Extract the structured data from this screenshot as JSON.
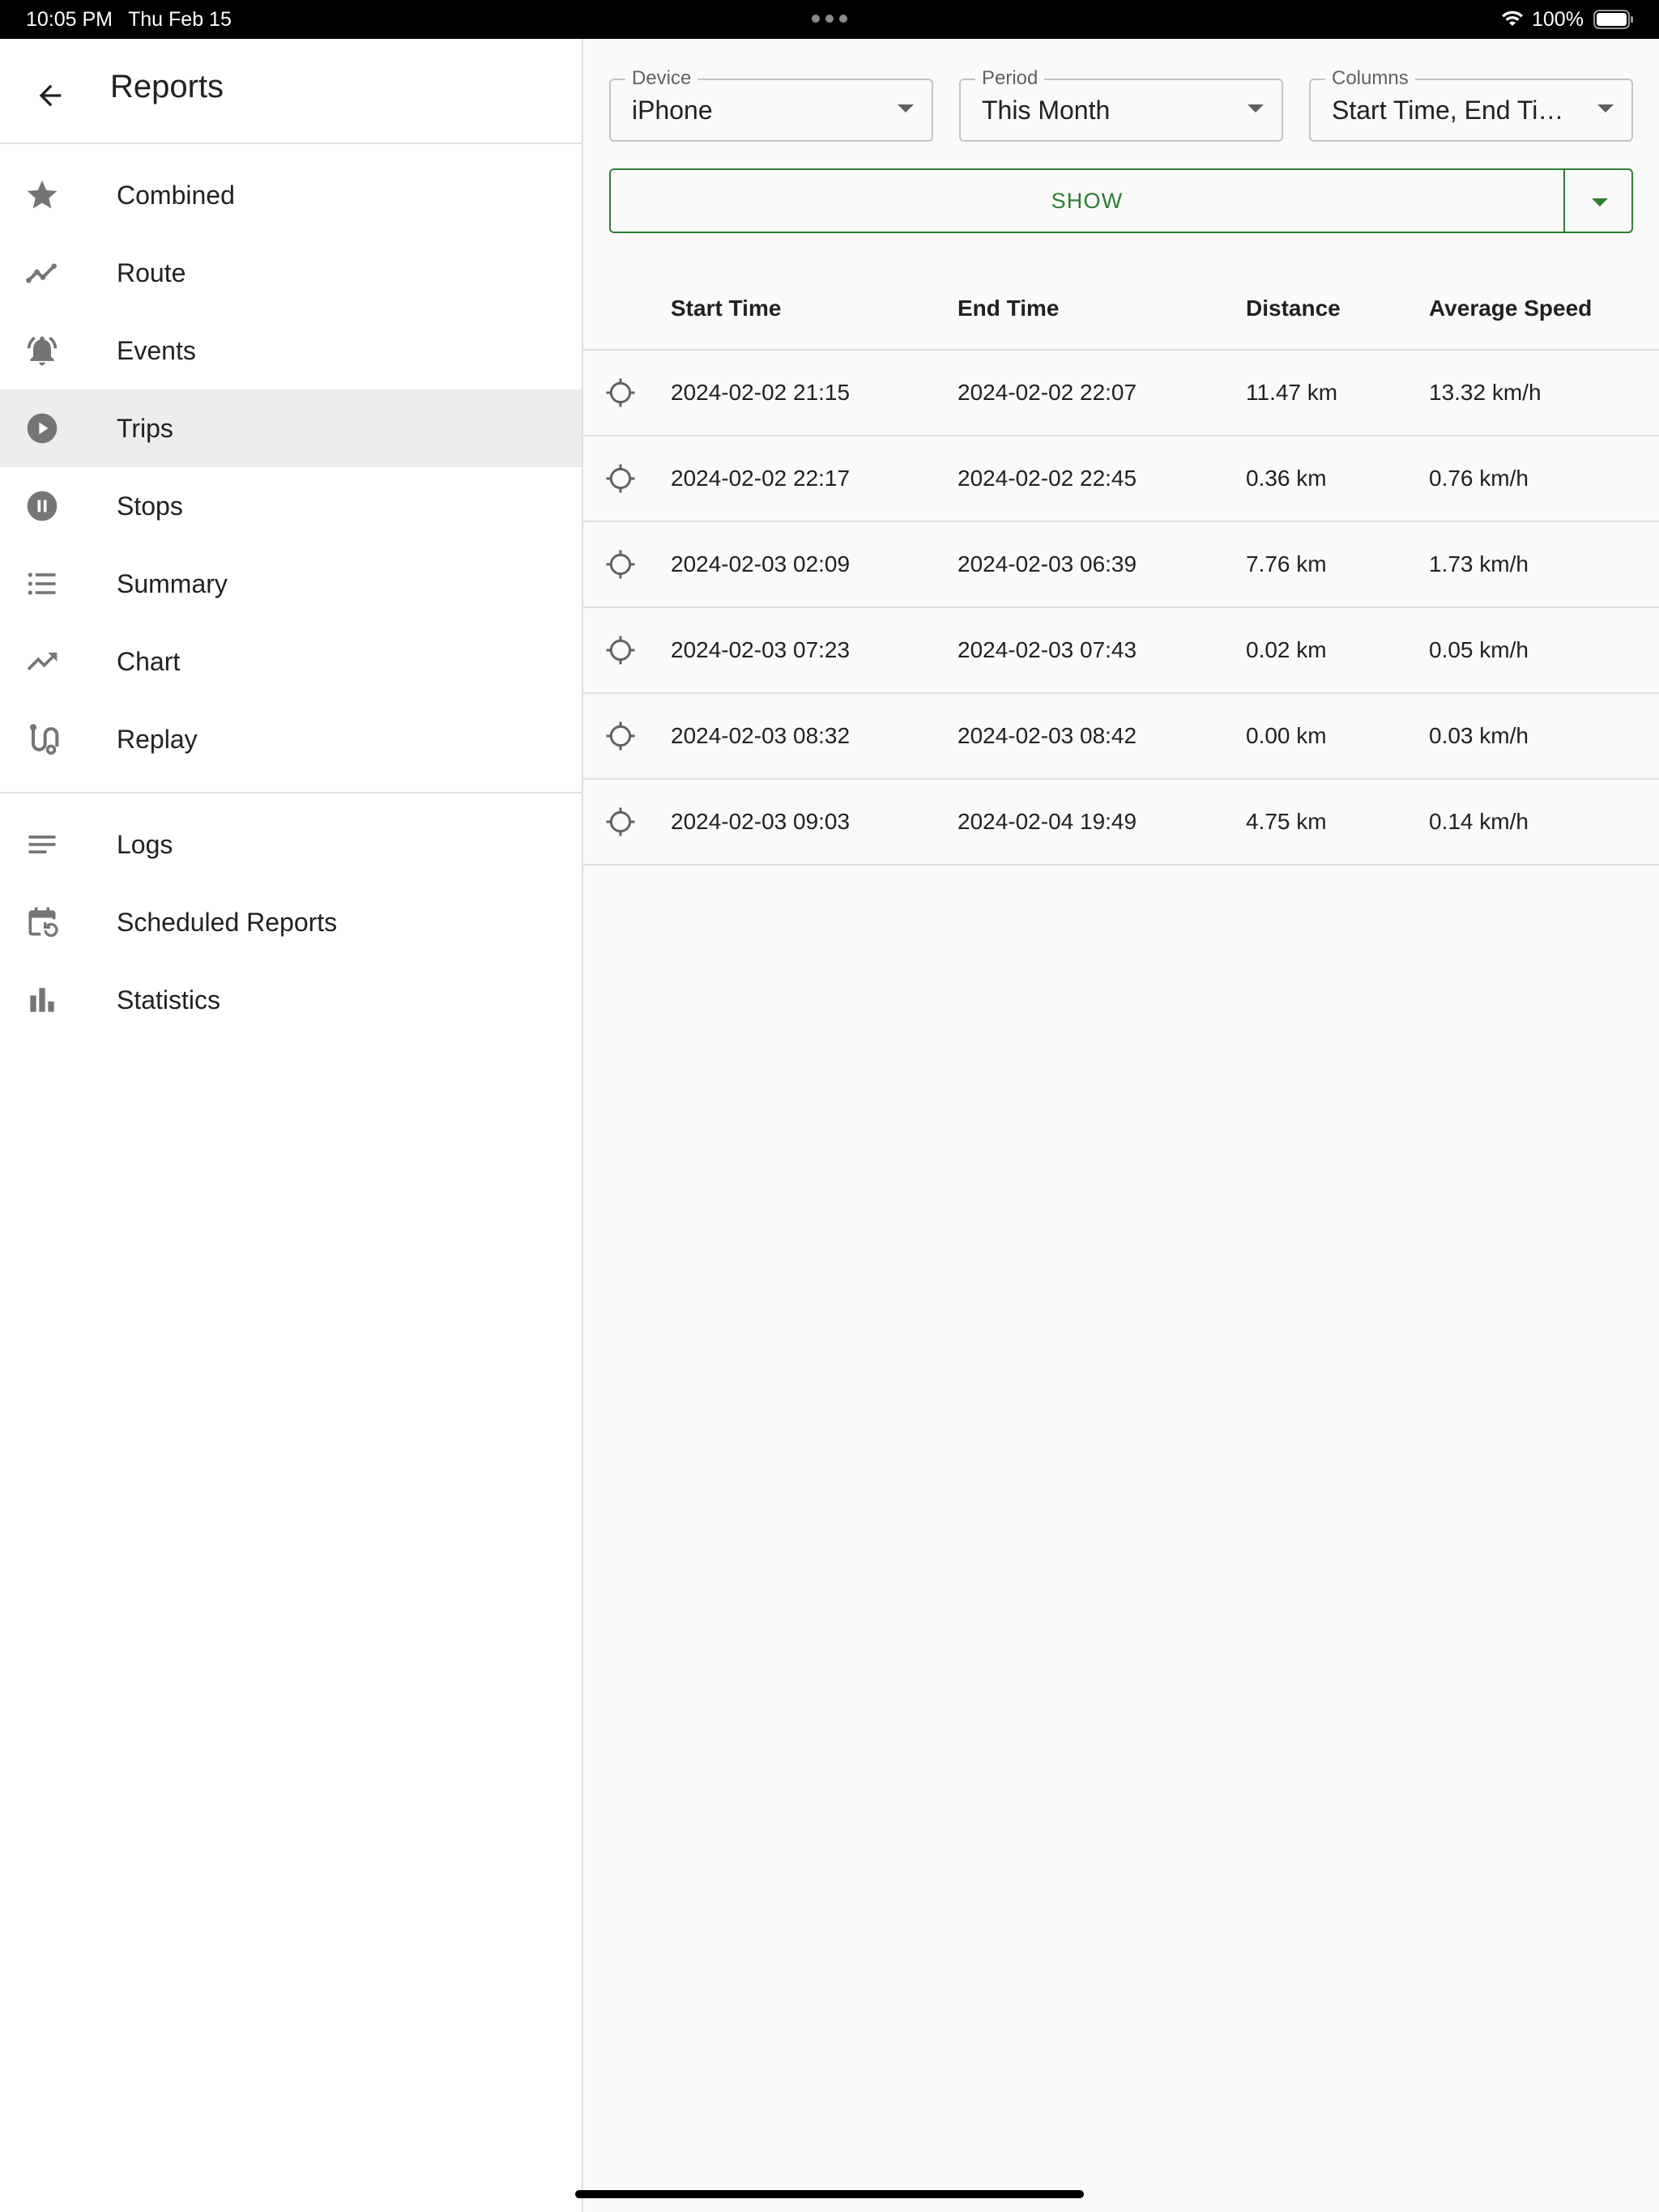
{
  "status_bar": {
    "time": "10:05 PM",
    "date": "Thu Feb 15",
    "battery": "100%",
    "icons": [
      "wifi-icon",
      "battery-icon",
      "multitasking-dots-icon"
    ]
  },
  "sidebar": {
    "title": "Reports",
    "back_icon": "arrow-left-icon",
    "items": [
      {
        "label": "Combined",
        "icon": "star-icon",
        "selected": false
      },
      {
        "label": "Route",
        "icon": "timeline-icon",
        "selected": false
      },
      {
        "label": "Events",
        "icon": "notifications-active-icon",
        "selected": false
      },
      {
        "label": "Trips",
        "icon": "play-circle-icon",
        "selected": true
      },
      {
        "label": "Stops",
        "icon": "pause-circle-icon",
        "selected": false
      },
      {
        "label": "Summary",
        "icon": "format-list-bulleted-icon",
        "selected": false
      },
      {
        "label": "Chart",
        "icon": "trending-up-icon",
        "selected": false
      },
      {
        "label": "Replay",
        "icon": "route-icon",
        "selected": false
      }
    ],
    "secondary_items": [
      {
        "label": "Logs",
        "icon": "notes-icon"
      },
      {
        "label": "Scheduled Reports",
        "icon": "event-repeat-icon"
      },
      {
        "label": "Statistics",
        "icon": "bar-chart-icon"
      }
    ]
  },
  "filters": {
    "device": {
      "label": "Device",
      "value": "iPhone"
    },
    "period": {
      "label": "Period",
      "value": "This Month"
    },
    "columns": {
      "label": "Columns",
      "value": "Start Time, End Time, Distance, Average Speed"
    },
    "show_label": "SHOW"
  },
  "colors": {
    "accent": "#2e7d32",
    "selected_bg": "#ededed",
    "divider": "#e0e0e0"
  },
  "table": {
    "columns": [
      "Start Time",
      "End Time",
      "Distance",
      "Average Speed"
    ],
    "row_icon": "gps-crosshair-icon",
    "rows": [
      [
        "2024-02-02 21:15",
        "2024-02-02 22:07",
        "11.47 km",
        "13.32 km/h"
      ],
      [
        "2024-02-02 22:17",
        "2024-02-02 22:45",
        "0.36 km",
        "0.76 km/h"
      ],
      [
        "2024-02-03 02:09",
        "2024-02-03 06:39",
        "7.76 km",
        "1.73 km/h"
      ],
      [
        "2024-02-03 07:23",
        "2024-02-03 07:43",
        "0.02 km",
        "0.05 km/h"
      ],
      [
        "2024-02-03 08:32",
        "2024-02-03 08:42",
        "0.00 km",
        "0.03 km/h"
      ],
      [
        "2024-02-03 09:03",
        "2024-02-04 19:49",
        "4.75 km",
        "0.14 km/h"
      ]
    ]
  }
}
